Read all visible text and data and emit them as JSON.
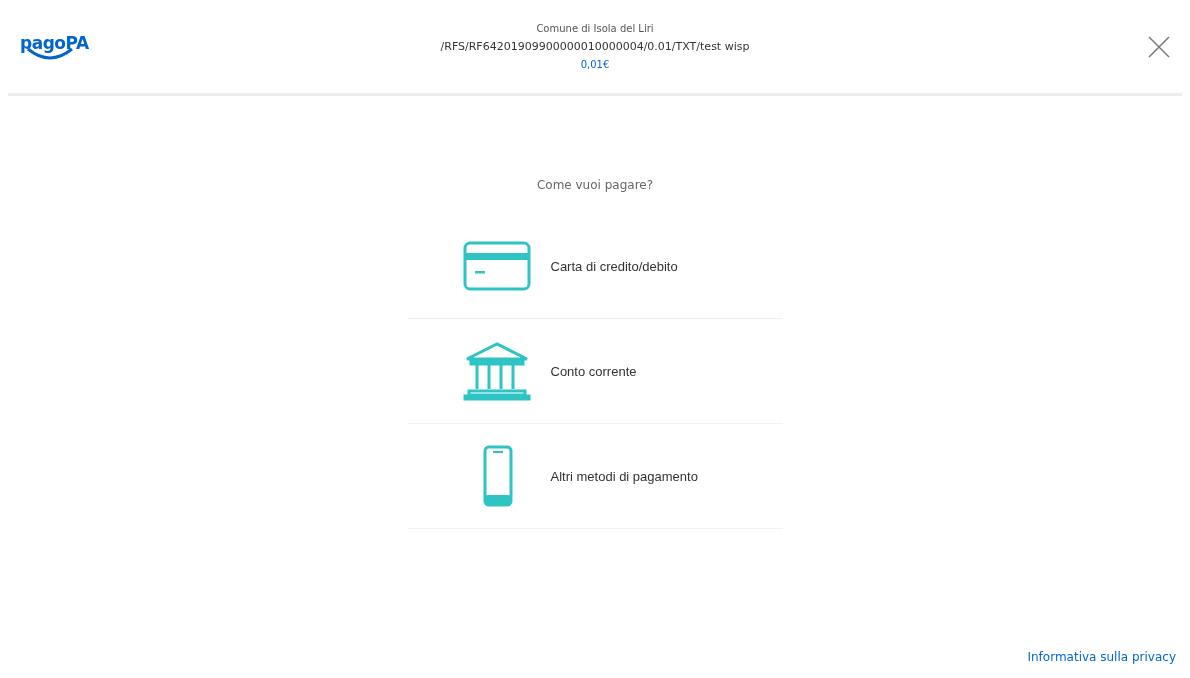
{
  "header": {
    "logo": "pagoPA",
    "creditor": "Comune di Isola del Liri",
    "reference": "/RFS/RF64201909900000010000004/0.01/TXT/test wisp",
    "amount": "0,01€"
  },
  "prompt": "Come vuoi pagare?",
  "methods": [
    {
      "kind": "card",
      "label": "Carta di credito/debito"
    },
    {
      "kind": "bank",
      "label": "Conto corrente"
    },
    {
      "kind": "phone",
      "label": "Altri metodi di pagamento"
    }
  ],
  "footer": {
    "privacy_link": "Informativa sulla privacy"
  }
}
